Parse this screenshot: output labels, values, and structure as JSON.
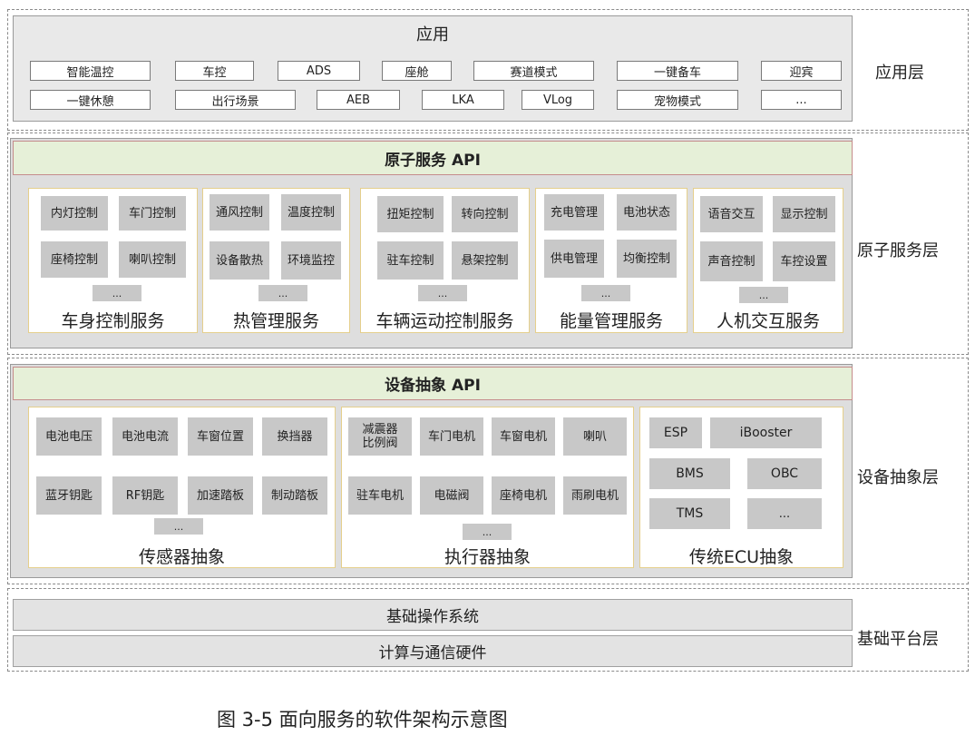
{
  "app_layer": {
    "title": "应用",
    "label": "应用层",
    "row1": [
      "智能温控",
      "车控",
      "ADS",
      "座舱",
      "赛道模式",
      "一键备车",
      "迎宾"
    ],
    "row2": [
      "一键休憩",
      "出行场景",
      "AEB",
      "LKA",
      "VLog",
      "宠物模式",
      "..."
    ]
  },
  "atomic_layer": {
    "api_title": "原子服务 API",
    "label": "原子服务层",
    "groups": [
      {
        "name": "车身控制服务",
        "items": [
          "内灯控制",
          "车门控制",
          "座椅控制",
          "喇叭控制"
        ],
        "more": "..."
      },
      {
        "name": "热管理服务",
        "items": [
          "通风控制",
          "温度控制",
          "设备散热",
          "环境监控"
        ],
        "more": "..."
      },
      {
        "name": "车辆运动控制服务",
        "items": [
          "扭矩控制",
          "转向控制",
          "驻车控制",
          "悬架控制"
        ],
        "more": "..."
      },
      {
        "name": "能量管理服务",
        "items": [
          "充电管理",
          "电池状态",
          "供电管理",
          "均衡控制"
        ],
        "more": "..."
      },
      {
        "name": "人机交互服务",
        "items": [
          "语音交互",
          "显示控制",
          "声音控制",
          "车控设置"
        ],
        "more": "..."
      }
    ]
  },
  "device_layer": {
    "api_title": "设备抽象 API",
    "label": "设备抽象层",
    "groups": [
      {
        "name": "传感器抽象",
        "items": [
          "电池电压",
          "电池电流",
          "车窗位置",
          "换挡器",
          "蓝牙钥匙",
          "RF钥匙",
          "加速踏板",
          "制动踏板"
        ],
        "more": "..."
      },
      {
        "name": "执行器抽象",
        "items": [
          "减震器\n比例阀",
          "车门电机",
          "车窗电机",
          "喇叭",
          "驻车电机",
          "电磁阀",
          "座椅电机",
          "雨刷电机"
        ],
        "more": "..."
      },
      {
        "name": "传统ECU抽象",
        "items": [
          "ESP",
          "iBooster",
          "BMS",
          "OBC",
          "TMS",
          "..."
        ]
      }
    ]
  },
  "base_layer": {
    "label": "基础平台层",
    "bars": [
      "基础操作系统",
      "计算与通信硬件"
    ]
  },
  "caption": "图 3-5 面向服务的软件架构示意图"
}
